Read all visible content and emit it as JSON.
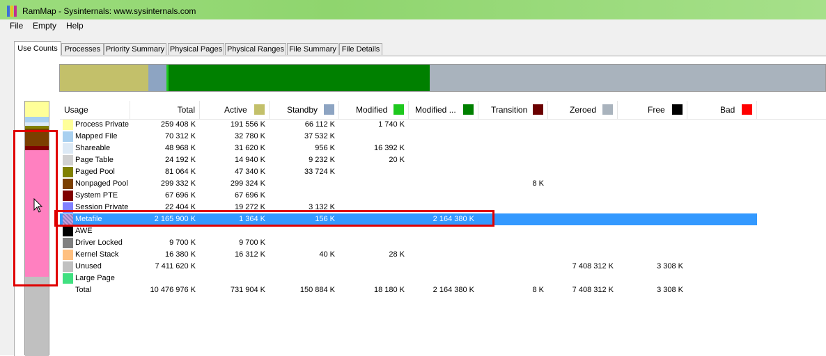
{
  "window": {
    "title": "RamMap - Sysinternals: www.sysinternals.com"
  },
  "menu": [
    "File",
    "Empty",
    "Help"
  ],
  "tabs": [
    {
      "label": "Use Counts",
      "active": true
    },
    {
      "label": "Processes"
    },
    {
      "label": "Priority Summary"
    },
    {
      "label": "Physical Pages"
    },
    {
      "label": "Physical Ranges"
    },
    {
      "label": "File Summary"
    },
    {
      "label": "File Details"
    }
  ],
  "columns": {
    "usage": "Usage",
    "total": "Total",
    "active": "Active",
    "standby": "Standby",
    "modified": "Modified",
    "modified_nowrite": "Modified ...",
    "transition": "Transition",
    "zeroed": "Zeroed",
    "free": "Free",
    "bad": "Bad"
  },
  "column_colors": {
    "active": "#c3c06a",
    "standby": "#8da4c2",
    "modified": "#1ec81e",
    "modified_nowrite": "#008000",
    "transition": "#6b0000",
    "zeroed": "#a9b3bd",
    "free": "#000000",
    "bad": "#ff0000"
  },
  "rows": [
    {
      "usage": "Process Private",
      "color": "#ffff99",
      "total": "259 408 K",
      "active": "191 556 K",
      "standby": "66 112 K",
      "modified": "1 740 K",
      "modified_nowrite": "",
      "transition": "",
      "zeroed": "",
      "free": ""
    },
    {
      "usage": "Mapped File",
      "color": "#a8d0f0",
      "total": "70 312 K",
      "active": "32 780 K",
      "standby": "37 532 K",
      "modified": "",
      "modified_nowrite": "",
      "transition": "",
      "zeroed": "",
      "free": ""
    },
    {
      "usage": "Shareable",
      "color": "#dce9f5",
      "total": "48 968 K",
      "active": "31 620 K",
      "standby": "956 K",
      "modified": "16 392 K",
      "modified_nowrite": "",
      "transition": "",
      "zeroed": "",
      "free": ""
    },
    {
      "usage": "Page Table",
      "color": "#d0d0d0",
      "total": "24 192 K",
      "active": "14 940 K",
      "standby": "9 232 K",
      "modified": "20 K",
      "modified_nowrite": "",
      "transition": "",
      "zeroed": "",
      "free": ""
    },
    {
      "usage": "Paged Pool",
      "color": "#808000",
      "total": "81 064 K",
      "active": "47 340 K",
      "standby": "33 724 K",
      "modified": "",
      "modified_nowrite": "",
      "transition": "",
      "zeroed": "",
      "free": ""
    },
    {
      "usage": "Nonpaged Pool",
      "color": "#7b3f00",
      "total": "299 332 K",
      "active": "299 324 K",
      "standby": "",
      "modified": "",
      "modified_nowrite": "",
      "transition": "8 K",
      "zeroed": "",
      "free": ""
    },
    {
      "usage": "System PTE",
      "color": "#800000",
      "total": "67 696 K",
      "active": "67 696 K",
      "standby": "",
      "modified": "",
      "modified_nowrite": "",
      "transition": "",
      "zeroed": "",
      "free": ""
    },
    {
      "usage": "Session Private",
      "color": "#8080ff",
      "total": "22 404 K",
      "active": "19 272 K",
      "standby": "3 132 K",
      "modified": "",
      "modified_nowrite": "",
      "transition": "",
      "zeroed": "",
      "free": ""
    },
    {
      "usage": "Metafile",
      "color": "#c8a0e0",
      "total": "2 165 900 K",
      "active": "1 364 K",
      "standby": "156 K",
      "modified": "",
      "modified_nowrite": "2 164 380 K",
      "transition": "",
      "zeroed": "",
      "free": "",
      "selected": true
    },
    {
      "usage": "AWE",
      "color": "#000000",
      "total": "",
      "active": "",
      "standby": "",
      "modified": "",
      "modified_nowrite": "",
      "transition": "",
      "zeroed": "",
      "free": ""
    },
    {
      "usage": "Driver Locked",
      "color": "#808080",
      "total": "9 700 K",
      "active": "9 700 K",
      "standby": "",
      "modified": "",
      "modified_nowrite": "",
      "transition": "",
      "zeroed": "",
      "free": ""
    },
    {
      "usage": "Kernel Stack",
      "color": "#ffc080",
      "total": "16 380 K",
      "active": "16 312 K",
      "standby": "40 K",
      "modified": "28 K",
      "modified_nowrite": "",
      "transition": "",
      "zeroed": "",
      "free": ""
    },
    {
      "usage": "Unused",
      "color": "#c0c0c0",
      "total": "7 411 620 K",
      "active": "",
      "standby": "",
      "modified": "",
      "modified_nowrite": "",
      "transition": "",
      "zeroed": "7 408 312 K",
      "free": "3 308 K"
    },
    {
      "usage": "Large Page",
      "color": "#40e080",
      "total": "",
      "active": "",
      "standby": "",
      "modified": "",
      "modified_nowrite": "",
      "transition": "",
      "zeroed": "",
      "free": ""
    },
    {
      "usage": "Total",
      "color": "",
      "total": "10 476 976 K",
      "active": "731 904 K",
      "standby": "150 884 K",
      "modified": "18 180 K",
      "modified_nowrite": "2 164 380 K",
      "transition": "8 K",
      "zeroed": "7 408 312 K",
      "free": "3 308 K"
    }
  ],
  "state_bar": [
    {
      "state": "Active",
      "color": "#c3c06a",
      "value_k": 731904
    },
    {
      "state": "Standby",
      "color": "#8da4c2",
      "value_k": 150884
    },
    {
      "state": "Modified",
      "color": "#1ec81e",
      "value_k": 18180
    },
    {
      "state": "Modified no write",
      "color": "#008000",
      "value_k": 2164380
    },
    {
      "state": "Zeroed",
      "color": "#a9b3bd",
      "value_k": 7408312
    }
  ],
  "total_k": 10476976
}
